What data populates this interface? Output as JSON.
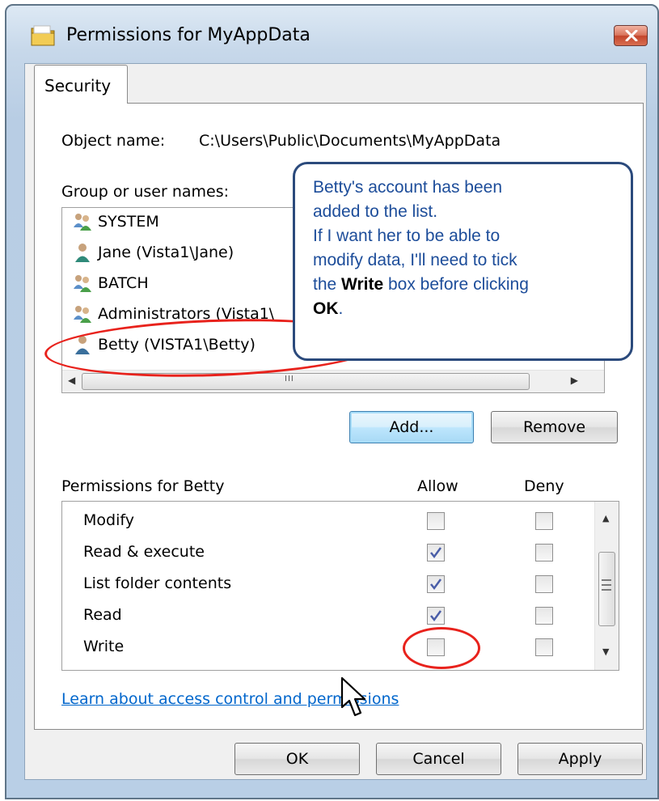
{
  "window": {
    "title": "Permissions for MyAppData",
    "close_icon": "close-icon",
    "folder_icon": "folder-icon"
  },
  "tabs": [
    {
      "label": "Security"
    }
  ],
  "object": {
    "label": "Object name:",
    "value": "C:\\Users\\Public\\Documents\\MyAppData"
  },
  "groups": {
    "label": "Group or user names:",
    "items": [
      {
        "name": "SYSTEM",
        "icon": "group-icon"
      },
      {
        "name": "Jane (Vista1\\Jane)",
        "icon": "user-icon"
      },
      {
        "name": "BATCH",
        "icon": "group-icon"
      },
      {
        "name": "Administrators (Vista1\\",
        "icon": "group-icon"
      },
      {
        "name": "Betty (VISTA1\\Betty)",
        "icon": "user-icon"
      }
    ]
  },
  "buttons": {
    "add": "Add...",
    "remove": "Remove",
    "ok": "OK",
    "cancel": "Cancel",
    "apply": "Apply"
  },
  "permissions": {
    "label": "Permissions for Betty",
    "allow_header": "Allow",
    "deny_header": "Deny",
    "rows": [
      {
        "name": "Modify",
        "allow": false,
        "deny": false
      },
      {
        "name": "Read & execute",
        "allow": true,
        "deny": false
      },
      {
        "name": "List folder contents",
        "allow": true,
        "deny": false
      },
      {
        "name": "Read",
        "allow": true,
        "deny": false
      },
      {
        "name": "Write",
        "allow": false,
        "deny": false
      }
    ]
  },
  "link": {
    "text": "Learn about access control and permissions"
  },
  "callout": {
    "line1": "Betty's account has been",
    "line2": "added to the list.",
    "line3": "If I want her to be able to",
    "line4": "modify data, I'll need to tick",
    "line5_pre": "the ",
    "line5_bold": "Write",
    "line5_post": " box before clicking",
    "line6_bold": "OK",
    "line6_post": "."
  },
  "colors": {
    "callout_text": "#1d4d9a",
    "callout_border": "#2b4a7c",
    "annotation_red": "#e8221c",
    "link": "#0066cc"
  }
}
